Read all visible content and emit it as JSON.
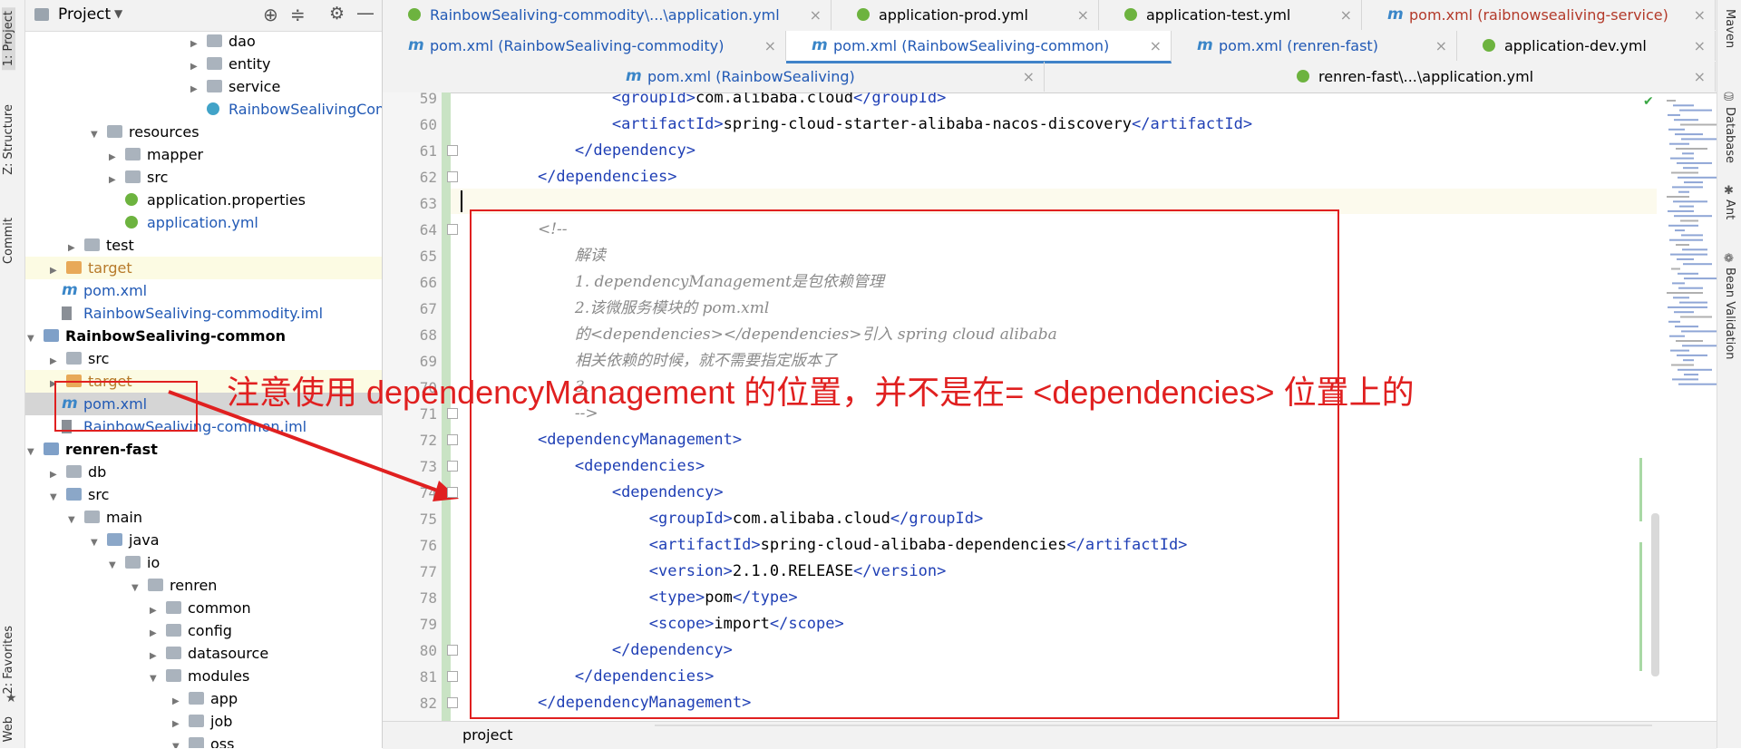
{
  "left_strip": {
    "project_label": "1: Project",
    "structure_label": "Z: Structure",
    "commit_label": "Commit",
    "favorites_label": "2: Favorites",
    "web_label": "Web"
  },
  "right_strip": {
    "maven_label": "Maven",
    "database_label": "Database",
    "ant_label": "Ant",
    "bean_label": "Bean Validation"
  },
  "project_panel": {
    "title": "Project",
    "tree": [
      {
        "label": "dao",
        "indent": 200,
        "icon": "folder",
        "arrow": "right",
        "color": "#000"
      },
      {
        "label": "entity",
        "indent": 200,
        "icon": "folder",
        "arrow": "right",
        "color": "#000"
      },
      {
        "label": "service",
        "indent": 200,
        "icon": "folder",
        "arrow": "right",
        "color": "#000"
      },
      {
        "label": "RainbowSealivingComm",
        "indent": 200,
        "icon": "class",
        "arrow": "",
        "color": "#2159b5"
      },
      {
        "label": "resources",
        "indent": 90,
        "icon": "res",
        "arrow": "down",
        "color": "#000"
      },
      {
        "label": "mapper",
        "indent": 110,
        "icon": "folder",
        "arrow": "right",
        "color": "#000"
      },
      {
        "label": "src",
        "indent": 110,
        "icon": "folder",
        "arrow": "right",
        "color": "#000"
      },
      {
        "label": "application.properties",
        "indent": 110,
        "icon": "spring",
        "arrow": "",
        "color": "#000"
      },
      {
        "label": "application.yml",
        "indent": 110,
        "icon": "spring",
        "arrow": "",
        "color": "#2159b5"
      },
      {
        "label": "test",
        "indent": 65,
        "icon": "folder",
        "arrow": "right",
        "color": "#000"
      },
      {
        "label": "target",
        "indent": 45,
        "icon": "target",
        "arrow": "right",
        "color": "#b77a2a"
      },
      {
        "label": "pom.xml",
        "indent": 40,
        "icon": "maven",
        "arrow": "",
        "color": "#2159b5"
      },
      {
        "label": "RainbowSealiving-commodity.iml",
        "indent": 40,
        "icon": "iml",
        "arrow": "",
        "color": "#2159b5"
      },
      {
        "label": "RainbowSealiving-common",
        "indent": 20,
        "icon": "module",
        "arrow": "down",
        "color": "#000",
        "bold": true
      },
      {
        "label": "src",
        "indent": 45,
        "icon": "folder",
        "arrow": "right",
        "color": "#000"
      },
      {
        "label": "target",
        "indent": 45,
        "icon": "target",
        "arrow": "right",
        "color": "#b77a2a"
      },
      {
        "label": "pom.xml",
        "indent": 40,
        "icon": "maven",
        "arrow": "",
        "color": "#2159b5",
        "selected": true
      },
      {
        "label": "RainbowSealiving-common.iml",
        "indent": 40,
        "icon": "iml",
        "arrow": "",
        "color": "#2159b5"
      },
      {
        "label": "renren-fast",
        "indent": 20,
        "icon": "module",
        "arrow": "down",
        "color": "#000",
        "bold": true
      },
      {
        "label": "db",
        "indent": 45,
        "icon": "folder",
        "arrow": "right",
        "color": "#000"
      },
      {
        "label": "src",
        "indent": 45,
        "icon": "src",
        "arrow": "down",
        "color": "#000"
      },
      {
        "label": "main",
        "indent": 65,
        "icon": "folder",
        "arrow": "down",
        "color": "#000"
      },
      {
        "label": "java",
        "indent": 90,
        "icon": "src",
        "arrow": "down",
        "color": "#000"
      },
      {
        "label": "io",
        "indent": 110,
        "icon": "folder",
        "arrow": "down",
        "color": "#000"
      },
      {
        "label": "renren",
        "indent": 135,
        "icon": "folder",
        "arrow": "down",
        "color": "#000"
      },
      {
        "label": "common",
        "indent": 155,
        "icon": "folder",
        "arrow": "right",
        "color": "#000"
      },
      {
        "label": "config",
        "indent": 155,
        "icon": "folder",
        "arrow": "right",
        "color": "#000"
      },
      {
        "label": "datasource",
        "indent": 155,
        "icon": "folder",
        "arrow": "right",
        "color": "#000"
      },
      {
        "label": "modules",
        "indent": 155,
        "icon": "folder",
        "arrow": "down",
        "color": "#000"
      },
      {
        "label": "app",
        "indent": 180,
        "icon": "folder",
        "arrow": "right",
        "color": "#000"
      },
      {
        "label": "job",
        "indent": 180,
        "icon": "folder",
        "arrow": "right",
        "color": "#000"
      },
      {
        "label": "oss",
        "indent": 180,
        "icon": "folder",
        "arrow": "down",
        "color": "#000"
      }
    ]
  },
  "tabs": {
    "row1": [
      {
        "label": "RainbowSealiving-commodity\\...\\application.yml",
        "icon": "spring",
        "color": "#2159b5"
      },
      {
        "label": "application-prod.yml",
        "icon": "spring",
        "color": "#000"
      },
      {
        "label": "application-test.yml",
        "icon": "spring",
        "color": "#000"
      },
      {
        "label": "pom.xml (raibnowsealiving-service)",
        "icon": "maven",
        "color": "#b33a2a"
      }
    ],
    "row2": [
      {
        "label": "pom.xml (RainbowSealiving-commodity)",
        "icon": "maven",
        "color": "#2159b5"
      },
      {
        "label": "pom.xml (RainbowSealiving-common)",
        "icon": "maven",
        "color": "#2159b5",
        "active": true
      },
      {
        "label": "pom.xml (renren-fast)",
        "icon": "maven",
        "color": "#2159b5"
      },
      {
        "label": "application-dev.yml",
        "icon": "spring",
        "color": "#000"
      }
    ],
    "row3": [
      {
        "label": "pom.xml (RainbowSealiving)",
        "icon": "maven",
        "color": "#2159b5"
      },
      {
        "label": "renren-fast\\...\\application.yml",
        "icon": "spring",
        "color": "#000"
      }
    ],
    "close_glyph": "×"
  },
  "editor": {
    "lines": [
      {
        "n": "59",
        "indent": "            ",
        "segs": [
          [
            "tag",
            "<groupId>"
          ],
          [
            "br",
            "com.alibaba.cloud"
          ],
          [
            "tag",
            "</groupId>"
          ]
        ]
      },
      {
        "n": "60",
        "indent": "            ",
        "segs": [
          [
            "tag",
            "<artifactId>"
          ],
          [
            "br",
            "spring-cloud-starter-alibaba-nacos-discovery"
          ],
          [
            "tag",
            "</artifactId>"
          ]
        ]
      },
      {
        "n": "61",
        "indent": "        ",
        "segs": [
          [
            "tag",
            "</dependency>"
          ]
        ]
      },
      {
        "n": "62",
        "indent": "    ",
        "segs": [
          [
            "tag",
            "</dependencies>"
          ]
        ]
      },
      {
        "n": "63",
        "indent": "",
        "segs": []
      },
      {
        "n": "64",
        "indent": "    ",
        "segs": [
          [
            "cm",
            "<!--"
          ]
        ]
      },
      {
        "n": "65",
        "indent": "        ",
        "segs": [
          [
            "cm",
            "解读"
          ]
        ]
      },
      {
        "n": "66",
        "indent": "        ",
        "segs": [
          [
            "cm",
            "1. dependencyManagement是包依赖管理"
          ]
        ]
      },
      {
        "n": "67",
        "indent": "        ",
        "segs": [
          [
            "cm",
            "2.该微服务模块的 pom.xml"
          ]
        ]
      },
      {
        "n": "68",
        "indent": "        ",
        "segs": [
          [
            "cm",
            "的<dependencies></dependencies>引入 spring cloud alibaba"
          ]
        ]
      },
      {
        "n": "69",
        "indent": "        ",
        "segs": [
          [
            "cm",
            "相关依赖的时候，就不需要指定版本了"
          ]
        ]
      },
      {
        "n": "70",
        "indent": "        ",
        "segs": [
          [
            "cm",
            "3. "
          ]
        ]
      },
      {
        "n": "71",
        "indent": "        ",
        "segs": [
          [
            "cm",
            "-->"
          ]
        ]
      },
      {
        "n": "72",
        "indent": "    ",
        "segs": [
          [
            "tag",
            "<dependencyManagement>"
          ]
        ]
      },
      {
        "n": "73",
        "indent": "        ",
        "segs": [
          [
            "tag",
            "<dependencies>"
          ]
        ]
      },
      {
        "n": "74",
        "indent": "            ",
        "segs": [
          [
            "tag",
            "<dependency>"
          ]
        ]
      },
      {
        "n": "75",
        "indent": "                ",
        "segs": [
          [
            "tag",
            "<groupId>"
          ],
          [
            "br",
            "com.alibaba.cloud"
          ],
          [
            "tag",
            "</groupId>"
          ]
        ]
      },
      {
        "n": "76",
        "indent": "                ",
        "segs": [
          [
            "tag",
            "<artifactId>"
          ],
          [
            "br",
            "spring-cloud-alibaba-dependencies"
          ],
          [
            "tag",
            "</artifactId>"
          ]
        ]
      },
      {
        "n": "77",
        "indent": "                ",
        "segs": [
          [
            "tag",
            "<version>"
          ],
          [
            "br",
            "2.1.0.RELEASE"
          ],
          [
            "tag",
            "</version>"
          ]
        ]
      },
      {
        "n": "78",
        "indent": "                ",
        "segs": [
          [
            "tag",
            "<type>"
          ],
          [
            "br",
            "pom"
          ],
          [
            "tag",
            "</type>"
          ]
        ]
      },
      {
        "n": "79",
        "indent": "                ",
        "segs": [
          [
            "tag",
            "<scope>"
          ],
          [
            "br",
            "import"
          ],
          [
            "tag",
            "</scope>"
          ]
        ]
      },
      {
        "n": "80",
        "indent": "            ",
        "segs": [
          [
            "tag",
            "</dependency>"
          ]
        ]
      },
      {
        "n": "81",
        "indent": "        ",
        "segs": [
          [
            "tag",
            "</dependencies>"
          ]
        ]
      },
      {
        "n": "82",
        "indent": "    ",
        "segs": [
          [
            "tag",
            "</dependencyManagement>"
          ]
        ]
      },
      {
        "n": "83",
        "indent": "",
        "segs": []
      }
    ]
  },
  "annotation": {
    "text": "注意使用  dependencyManagement 的位置，并不是在= <dependencies> 位置上的",
    "color": "#e02020"
  },
  "status": {
    "breadcrumb": "project"
  }
}
